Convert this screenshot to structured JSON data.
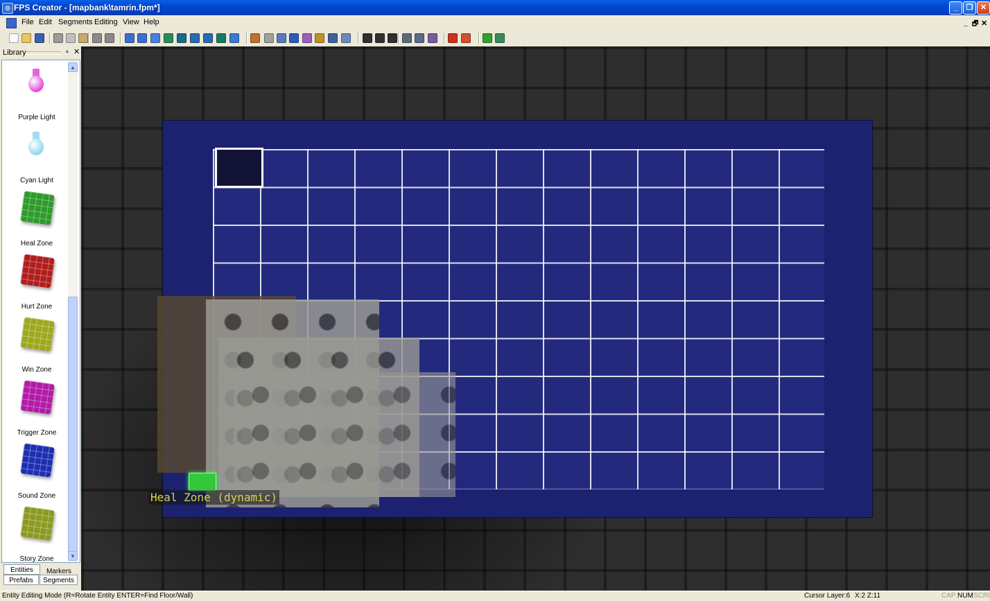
{
  "window": {
    "title": "FPS Creator - [mapbank\\tamrin.fpm*]",
    "buttons": {
      "minimize": "_",
      "maximize": "❐",
      "close": "✕"
    }
  },
  "menubar": {
    "items": [
      "File",
      "Edit",
      "Segments",
      "Editing",
      "View",
      "Help"
    ],
    "mdi_controls": {
      "minimize": "_",
      "restore": "🗗",
      "close": "✕"
    }
  },
  "toolbar": {
    "icons": [
      "new-file",
      "open-file",
      "save",
      "cut",
      "copy",
      "paste",
      "undo",
      "redo",
      "zoom-in",
      "zoom-out",
      "view-1",
      "view-2",
      "layers",
      "layer-up",
      "layer-down",
      "picture",
      "magnifier",
      "paint-segment",
      "erase-segment",
      "pick-segment",
      "paint-prefab",
      "rotate",
      "flip",
      "pick",
      "select-area",
      "line-tool",
      "box-tool",
      "circle-tool",
      "entity-tool-1",
      "entity-tool-2",
      "entity-tool-3",
      "player-start-flag",
      "multiplayer-flag",
      "test-game",
      "build-game"
    ]
  },
  "library": {
    "title": "Library",
    "items": [
      {
        "label": "Purple Light",
        "kind": "bulb",
        "color": "#e24ad8"
      },
      {
        "label": "Cyan Light",
        "kind": "bulb",
        "color": "#8fd6f4"
      },
      {
        "label": "Heal Zone",
        "kind": "cube",
        "color": "#2e9a2a"
      },
      {
        "label": "Hurt Zone",
        "kind": "cube",
        "color": "#b11d1d"
      },
      {
        "label": "Win Zone",
        "kind": "cube",
        "color": "#9ea81e"
      },
      {
        "label": "Trigger Zone",
        "kind": "cube",
        "color": "#b21ba6"
      },
      {
        "label": "Sound Zone",
        "kind": "cube",
        "color": "#1c2fb2"
      },
      {
        "label": "Story Zone",
        "kind": "cube",
        "color": "#8c9a22"
      }
    ],
    "tabs": [
      "Entities",
      "Markers",
      "Prefabs",
      "Segments"
    ]
  },
  "viewport": {
    "entity_label": "Heal Zone (dynamic)"
  },
  "statusbar": {
    "mode": "Entity Editing Mode (R=Rotate Entity  ENTER=Find Floor/Wall)",
    "cursor": "Cursor Layer:6",
    "coords": "X:2  Z:11",
    "indicators": [
      "CAP",
      "NUM",
      "SCRL"
    ],
    "active_indicator": "NUM"
  }
}
